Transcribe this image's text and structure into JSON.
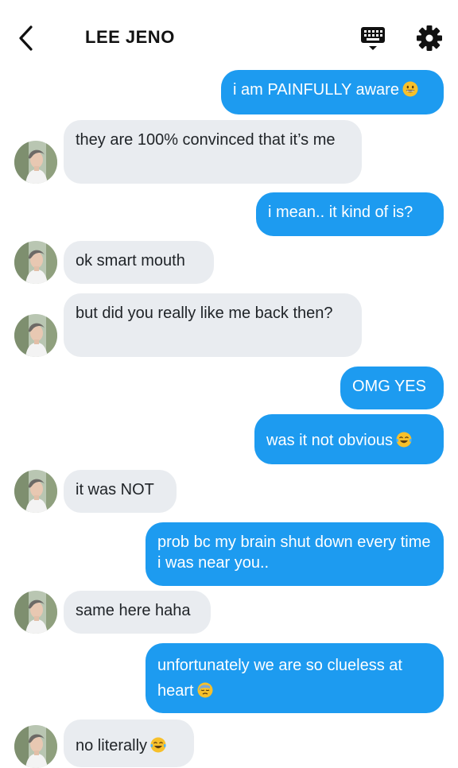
{
  "header": {
    "title": "LEE JENO",
    "back_icon": "chevron-left-icon",
    "keyboard_icon": "keyboard-icon",
    "settings_icon": "gear-icon"
  },
  "colors": {
    "sent_bubble": "#1d9bf0",
    "received_bubble": "#e9ecf0",
    "emoji_yellow": "#f7c02b"
  },
  "messages": [
    {
      "from": "me",
      "text": "i am PAINFULLY aware",
      "emoji": "grinning-face-icon"
    },
    {
      "from": "them",
      "text": "they are 100% convinced that it’s me"
    },
    {
      "from": "me",
      "text": "i mean.. it kind of is?"
    },
    {
      "from": "them",
      "text": "ok smart mouth"
    },
    {
      "from": "them",
      "text": "but did you really like me back then?"
    },
    {
      "from": "me",
      "text": "OMG YES"
    },
    {
      "from": "me",
      "text": "was it not obvious",
      "emoji": "crying-laughing-face-icon"
    },
    {
      "from": "them",
      "text": "it was NOT"
    },
    {
      "from": "me",
      "text": "prob bc my brain shut down every time i was near you.."
    },
    {
      "from": "them",
      "text": "same here haha"
    },
    {
      "from": "me",
      "text": "unfortunately we are so clueless at heart",
      "emoji": "downcast-sweat-face-icon"
    },
    {
      "from": "them",
      "text": "no literally",
      "emoji": "crying-laughing-face-icon"
    }
  ]
}
